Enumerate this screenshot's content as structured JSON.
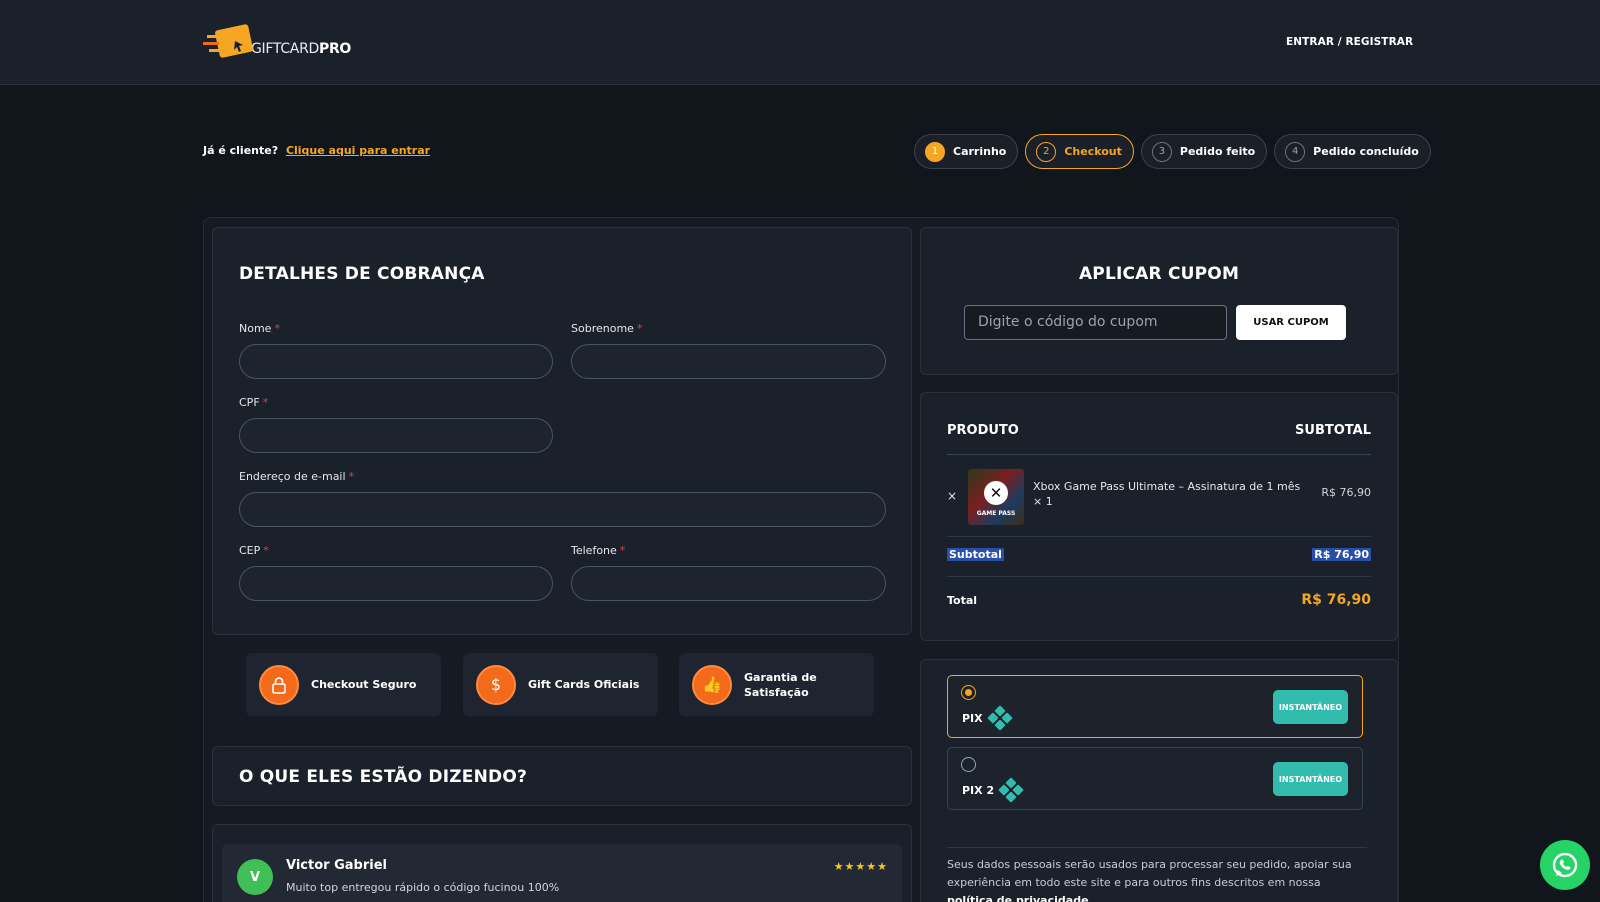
{
  "header": {
    "brand_prefix": "GIFTCARD",
    "brand_suffix": "PRO",
    "login_label": "ENTRAR / REGISTRAR"
  },
  "client": {
    "question": "Já é cliente?",
    "link": "Clique aqui para entrar"
  },
  "steps": [
    {
      "num": "1",
      "label": "Carrinho"
    },
    {
      "num": "2",
      "label": "Checkout"
    },
    {
      "num": "3",
      "label": "Pedido feito"
    },
    {
      "num": "4",
      "label": "Pedido concluído"
    }
  ],
  "billing": {
    "title": "DETALHES DE COBRANÇA",
    "required_mark": "*",
    "fields": {
      "nome": "Nome",
      "sobrenome": "Sobrenome",
      "cpf": "CPF",
      "email": "Endereço de e-mail",
      "cep": "CEP",
      "telefone": "Telefone"
    }
  },
  "coupon": {
    "title": "APLICAR CUPOM",
    "placeholder": "Digite o código do cupom",
    "button": "USAR CUPOM"
  },
  "order": {
    "col_product": "PRODUTO",
    "col_subtotal": "SUBTOTAL",
    "remove_symbol": "×",
    "thumb_caption": "GAME PASS",
    "product_name": "Xbox Game Pass Ultimate – Assinatura de 1 mês",
    "product_qty": "× 1",
    "product_price": "R$ 76,90",
    "subtotal_label": "Subtotal",
    "subtotal_value": "R$ 76,90",
    "total_label": "Total",
    "total_value": "R$ 76,90"
  },
  "payment": {
    "options": [
      {
        "label": "PIX",
        "badge": "INSTANTÂNEO",
        "selected": true
      },
      {
        "label": "PIX 2",
        "badge": "INSTANTÂNEO",
        "selected": false
      }
    ],
    "privacy_text": "Seus dados pessoais serão usados para processar seu pedido, apoiar sua experiência em todo este site e para outros fins descritos em nossa",
    "privacy_link": "política de privacidade",
    "privacy_end": "."
  },
  "badges": [
    {
      "label": "Checkout Seguro",
      "icon": "lock-icon"
    },
    {
      "label": "Gift Cards Oficiais",
      "icon": "dollar-coin-icon"
    },
    {
      "label": "Garantia de Satisfação",
      "icon": "thumbs-up-icon"
    }
  ],
  "testimonials": {
    "title": "O QUE ELES ESTÃO DIZENDO?",
    "review": {
      "initial": "V",
      "name": "Victor Gabriel",
      "text": "Muito top entregou rápido o código fucinou 100%",
      "stars": "★★★★★",
      "rating": 5
    }
  },
  "colors": {
    "accent": "#f5a623",
    "pix": "#32bcad",
    "whatsapp": "#25d366"
  }
}
